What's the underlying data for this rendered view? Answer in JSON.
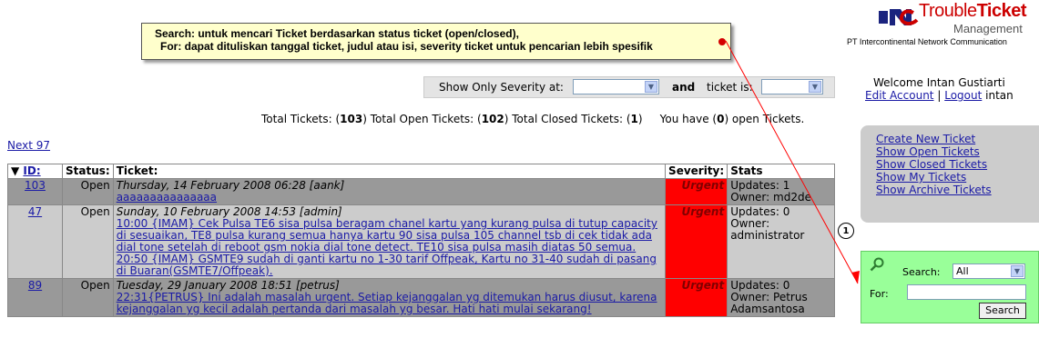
{
  "tooltip": {
    "line1": "Search: untuk mencari Ticket berdasarkan status ticket (open/closed),",
    "line2": "For: dapat dituliskan tanggal ticket, judul atau isi, severity ticket untuk pencarian lebih spesifik"
  },
  "logo": {
    "brand_prefix": "Trouble",
    "brand_bold": "Ticket",
    "subtitle": "Management",
    "company": "PT Intercontinental Network Communication"
  },
  "user": {
    "welcome": "Welcome Intan Gustiarti",
    "edit_account": "Edit Account",
    "separator": "|",
    "logout": "Logout",
    "username": "intan"
  },
  "filter": {
    "severity_label": "Show Only Severity at:",
    "severity_value": "",
    "and_label": "and",
    "status_label": "ticket is:",
    "status_value": ""
  },
  "totals": {
    "p1": "Total Tickets: (",
    "total": "103",
    "p2": ") Total Open Tickets: (",
    "open": "102",
    "p3": ") Total Closed Tickets: (",
    "closed": "1",
    "p4": ")     You have (",
    "mine": "0",
    "p5": ") open Tickets."
  },
  "pager": {
    "next": "Next 97"
  },
  "table": {
    "headers": {
      "id": "ID:",
      "status": "Status:",
      "ticket": "Ticket:",
      "severity": "Severity:",
      "stats": "Stats"
    },
    "rows": [
      {
        "id": "103",
        "status": "Open",
        "date": "Thursday, 14 February 2008 06:28 [aank]",
        "body": "aaaaaaaaaaaaaaa",
        "severity": "Urgent",
        "stats": "Updates: 1  Owner: md2de"
      },
      {
        "id": "47",
        "status": "Open",
        "date": "Sunday, 10 February 2008 14:53 [admin]",
        "body": "10:00 {IMAM} Cek Pulsa TE6 sisa pulsa beragam chanel kartu yang kurang pulsa di tutup capacity di sesuaikan, TE8 pulsa kurang semua hanya kartu 90 sisa pulsa 105 channel tsb di cek tidak ada dial tone setelah di reboot gsm nokia dial tone detect. TE10 sisa pulsa masih diatas 50 semua. 20:50 {IMAM} GSMTE9 sudah di ganti kartu no 1-30 tarif Offpeak, Kartu no 31-40 sudah di pasang di Buaran(GSMTE7/Offpeak).",
        "severity": "Urgent",
        "stats": "Updates: 0  Owner: administrator"
      },
      {
        "id": "89",
        "status": "Open",
        "date": "Tuesday, 29 January 2008 18:51 [petrus]",
        "body": "22:31{PETRUS} Ini adalah masalah urgent. Setiap kejanggalan yg ditemukan harus diusut, karena kejanggalan yg kecil adalah pertanda dari masalah yg besar. Hati hati mulai sekarang!",
        "severity": "Urgent",
        "stats": "Updates: 0  Owner: Petrus Adamsantosa"
      }
    ]
  },
  "menu": {
    "items": [
      "Create New Ticket",
      "Show Open Tickets",
      "Show Closed Tickets",
      "Show My Tickets",
      "Show Archive Tickets"
    ]
  },
  "annotation": {
    "marker": "1"
  },
  "search": {
    "search_label": "Search:",
    "search_value": "All",
    "for_label": "For:",
    "for_value": "",
    "button": "Search"
  },
  "colors": {
    "urgent": "#ff0000",
    "row_dark": "#999999",
    "row_light": "#cccccc",
    "search_panel": "#99ff99",
    "tooltip_bg": "#ffffcc",
    "brand_red": "#cc0000"
  }
}
